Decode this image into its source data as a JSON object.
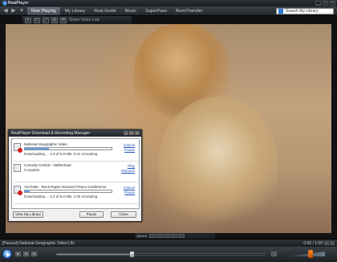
{
  "app": {
    "title": "RealPlayer"
  },
  "nav": {
    "tabs": [
      {
        "label": "Now Playing",
        "active": true
      },
      {
        "label": "My Library"
      },
      {
        "label": "Real Guide"
      },
      {
        "label": "Music"
      },
      {
        "label": "SuperPass"
      },
      {
        "label": "Burn/Transfer"
      }
    ],
    "search_placeholder": "Search My Library"
  },
  "video_toolbar": {
    "share_label": "Share Video Link"
  },
  "download_dialog": {
    "title": "RealPlayer Download & Recording Manager",
    "items": [
      {
        "name": "National Geographic Video",
        "status": "Downloading ... 1.9 of 6.9 MB, 0:24 remaining",
        "progress": 0.28,
        "links": [
          "Cancel",
          "Pause"
        ]
      },
      {
        "name": "Comedy Central - Nutherload",
        "status": "Complete",
        "progress": null,
        "links": [
          "Play",
          "Remove"
        ]
      },
      {
        "name": "YouTube - Rock-Paper-Scissors Peace Conference",
        "status": "Downloading ... 0.3 of 5.0 MB, 1:00 remaining",
        "progress": 0.06,
        "links": [
          "Cancel",
          "Pause"
        ]
      }
    ],
    "footer": {
      "library": "View My Library",
      "pause": "Pause",
      "close": "Close"
    }
  },
  "speed": {
    "label": "Speed"
  },
  "status": {
    "text": "[Paused] National Geographic Video1.flv",
    "time": "0:00 / 1:00"
  },
  "playback": {
    "position": 0.36,
    "volume": 0.75
  },
  "colors": {
    "accent": "#2f82e0",
    "link": "#1b4fb5",
    "volume": "#ff8a2a"
  }
}
